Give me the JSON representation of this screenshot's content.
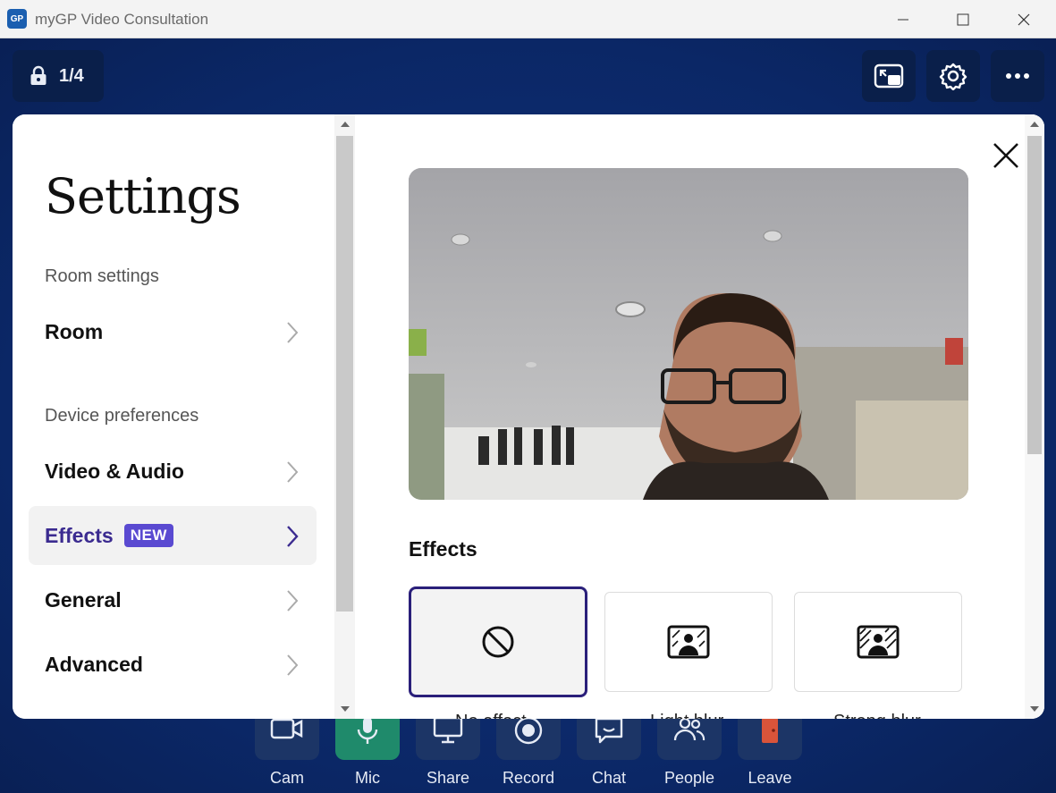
{
  "window": {
    "title": "myGP Video Consultation",
    "logo_text": "GP"
  },
  "call": {
    "participants_count": "1/4",
    "top_buttons": [
      "pip-icon",
      "gear-icon",
      "more-icon"
    ],
    "toolbar": [
      {
        "label": "Cam",
        "icon": "camera-icon"
      },
      {
        "label": "Mic",
        "icon": "microphone-icon"
      },
      {
        "label": "Share",
        "icon": "screen-share-icon"
      },
      {
        "label": "Record",
        "icon": "record-icon"
      },
      {
        "label": "Chat",
        "icon": "chat-icon"
      },
      {
        "label": "People",
        "icon": "people-icon"
      },
      {
        "label": "Leave",
        "icon": "door-icon"
      }
    ]
  },
  "settings": {
    "title": "Settings",
    "sections": {
      "room_label": "Room settings",
      "device_label": "Device preferences"
    },
    "nav": {
      "room": "Room",
      "video_audio": "Video & Audio",
      "effects": "Effects",
      "effects_badge": "NEW",
      "general": "General",
      "advanced": "Advanced"
    },
    "effects_panel": {
      "title": "Effects",
      "options": [
        {
          "label": "No effect",
          "icon": "no-effect-icon",
          "selected": true
        },
        {
          "label": "Light blur",
          "icon": "light-blur-icon",
          "selected": false
        },
        {
          "label": "Strong blur",
          "icon": "strong-blur-icon",
          "selected": false
        }
      ]
    }
  },
  "colors": {
    "accent": "#3b2b90",
    "badge": "#5a4ad1",
    "background": "#0d2a6b",
    "mic_active": "#1f8a6b",
    "leave_icon": "#d9543a"
  }
}
